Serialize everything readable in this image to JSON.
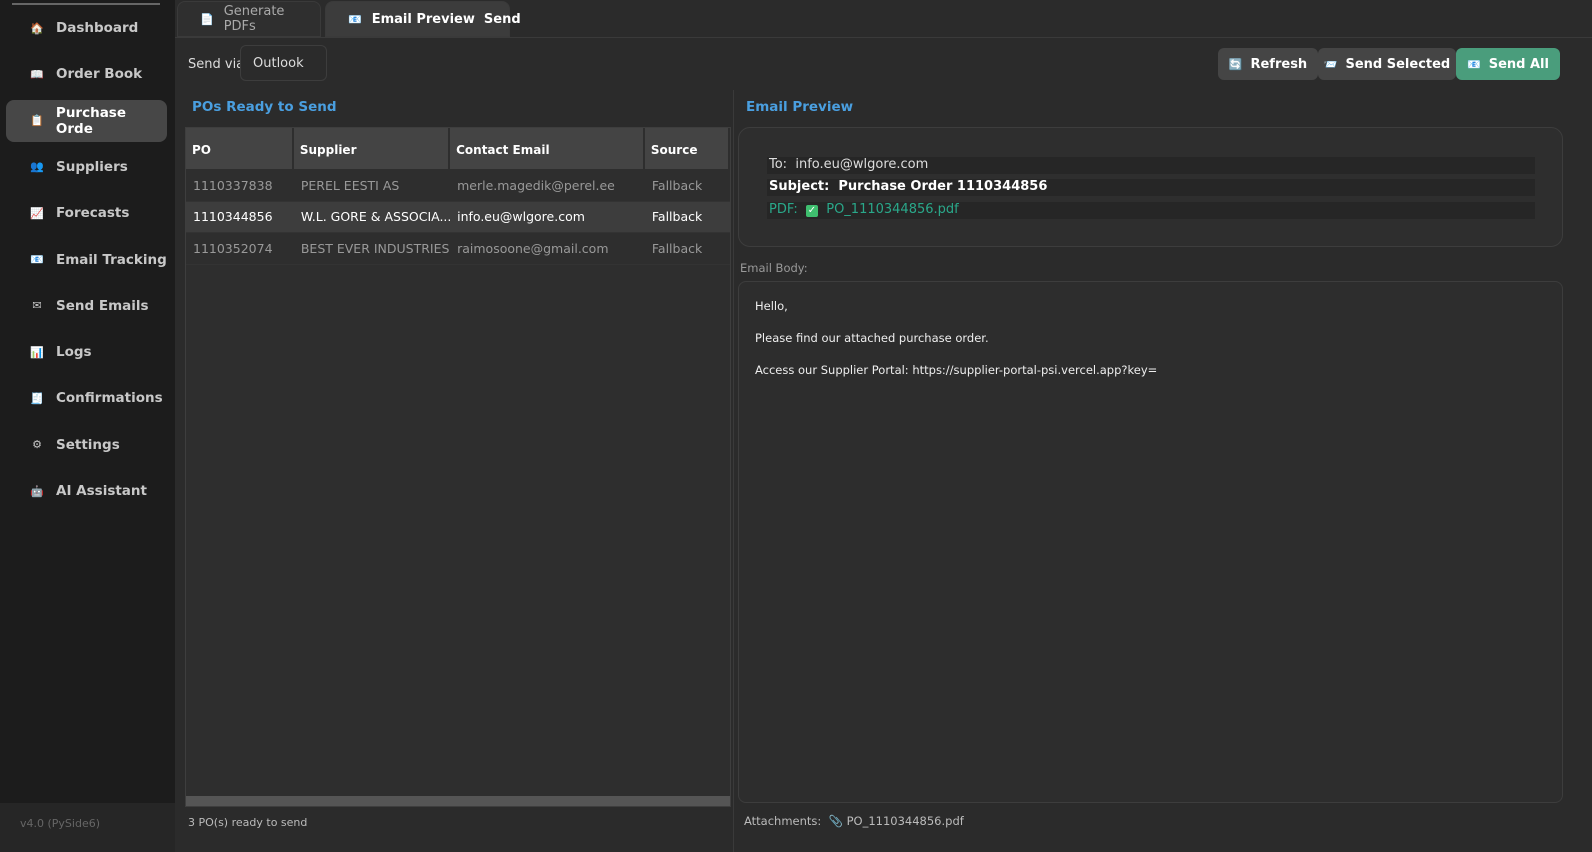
{
  "sidebar": {
    "items": [
      {
        "label": "Dashboard",
        "icon": "house-icon",
        "glyph": "🏠"
      },
      {
        "label": "Order Book",
        "icon": "book-icon",
        "glyph": "📖"
      },
      {
        "label": "Purchase Orde",
        "icon": "clipboard-icon",
        "glyph": "📋",
        "active": true
      },
      {
        "label": "Suppliers",
        "icon": "people-icon",
        "glyph": "👥"
      },
      {
        "label": "Forecasts",
        "icon": "chart-up-icon",
        "glyph": "📈"
      },
      {
        "label": "Email Tracking",
        "icon": "email-icon",
        "glyph": "📧"
      },
      {
        "label": "Send Emails",
        "icon": "envelope-icon",
        "glyph": "✉"
      },
      {
        "label": "Logs",
        "icon": "bar-chart-icon",
        "glyph": "📊"
      },
      {
        "label": "Confirmations",
        "icon": "receipt-icon",
        "glyph": "🧾"
      },
      {
        "label": "Settings",
        "icon": "gear-icon",
        "glyph": "⚙"
      },
      {
        "label": "AI Assistant",
        "icon": "robot-icon",
        "glyph": "🤖"
      }
    ],
    "version": "v4.0 (PySide6)"
  },
  "tabs": [
    {
      "label": "Generate PDFs",
      "glyph": "📄"
    },
    {
      "label": "Email Preview  Send",
      "glyph": "📧",
      "active": true
    }
  ],
  "toolbar": {
    "send_via_label": "Send via:",
    "send_via_value": "Outlook",
    "refresh": "Refresh",
    "send_selected": "Send Selected",
    "send_all": "Send All"
  },
  "left": {
    "title": "POs Ready to Send",
    "columns": [
      "PO",
      "Supplier",
      "Contact Email",
      "Source"
    ],
    "rows": [
      [
        "1110337838",
        "PEREL EESTI AS",
        "merle.magedik@perel.ee",
        "Fallback"
      ],
      [
        "1110344856",
        "W.L. GORE & ASSOCIA...",
        "info.eu@wlgore.com",
        "Fallback"
      ],
      [
        "1110352074",
        "BEST EVER INDUSTRIES...",
        "raimosoone@gmail.com",
        "Fallback"
      ]
    ],
    "selected_row": 1,
    "status": "3 PO(s) ready to send"
  },
  "right": {
    "title": "Email Preview",
    "to_label": "To:",
    "to": "info.eu@wlgore.com",
    "subject_label": "Subject:",
    "subject": "Purchase Order 1110344856",
    "pdf_label": "PDF:",
    "pdf": "PO_1110344856.pdf",
    "body_label": "Email Body:",
    "body": [
      "Hello,",
      "Please find our attached purchase order.",
      "Access our Supplier Portal: https://supplier-portal-psi.vercel.app?key="
    ],
    "attachments_label": "Attachments:",
    "attachment": "PO_1110344856.pdf"
  },
  "colors": {
    "accent": "#4a9fe0",
    "send_all": "#4a9d7c",
    "pdf": "#2aa88a"
  }
}
